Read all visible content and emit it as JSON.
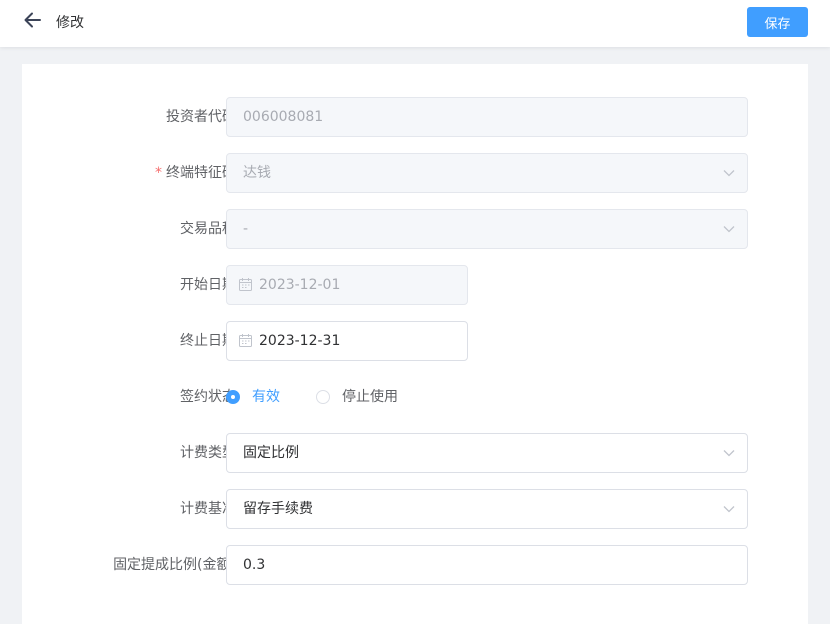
{
  "header": {
    "back_icon": "arrow-left-icon",
    "title": "修改",
    "save_label": "保存"
  },
  "form": {
    "investor_code": {
      "label": "投资者代码",
      "value": "006008081",
      "disabled": true
    },
    "terminal_code": {
      "label": "终端特征码",
      "required": true,
      "value": "达钱",
      "disabled": true
    },
    "trade_variety": {
      "label": "交易品种",
      "value": "-",
      "disabled": true
    },
    "start_date": {
      "label": "开始日期",
      "value": "2023-12-01",
      "disabled": true
    },
    "end_date": {
      "label": "终止日期",
      "value": "2023-12-31"
    },
    "sign_status": {
      "label": "签约状态",
      "options": [
        "有效",
        "停止使用"
      ],
      "selected": "有效"
    },
    "fee_type": {
      "label": "计费类型",
      "value": "固定比例"
    },
    "fee_base": {
      "label": "计费基准",
      "value": "留存手续费"
    },
    "fixed_ratio": {
      "label": "固定提成比例(金额)",
      "value": "0.3"
    }
  },
  "colors": {
    "primary": "#409eff",
    "required": "#f56c6c",
    "disabled_bg": "#f5f7fa"
  }
}
